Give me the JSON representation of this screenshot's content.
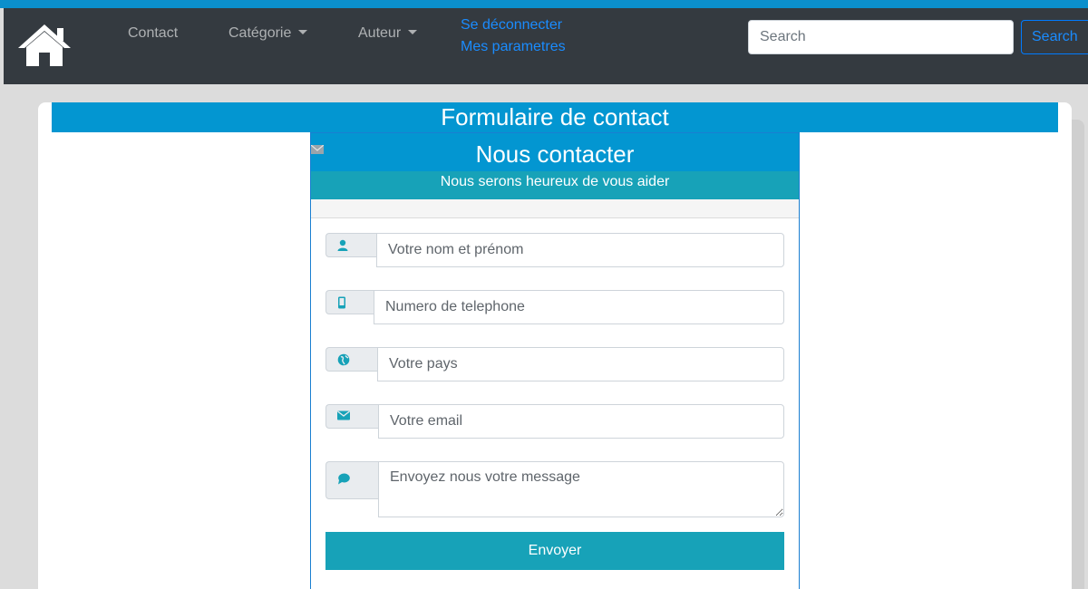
{
  "nav": {
    "home_icon": "home-icon",
    "contact": "Contact",
    "categorie": "Catégorie",
    "auteur": "Auteur",
    "logout": "Se déconnecter",
    "settings": "Mes parametres",
    "search_placeholder": "Search",
    "search_button": "Search"
  },
  "page": {
    "title": "Formulaire de contact"
  },
  "contact": {
    "title": "Nous contacter",
    "subtitle": "Nous serons heureux de vous aider",
    "fields": [
      {
        "icon": "user-icon",
        "placeholder": "Votre nom et prénom"
      },
      {
        "icon": "mobile-icon",
        "placeholder": "Numero de telephone"
      },
      {
        "icon": "globe-icon",
        "placeholder": "Votre pays"
      },
      {
        "icon": "envelope-icon",
        "placeholder": "Votre email"
      },
      {
        "icon": "comment-icon",
        "placeholder": "Envoyez nous votre message"
      }
    ],
    "submit": "Envoyer"
  },
  "colors": {
    "navbar": "#343a40",
    "primary_blue": "#0396d1",
    "teal": "#17a2b8",
    "link_blue": "#1a8cff"
  }
}
